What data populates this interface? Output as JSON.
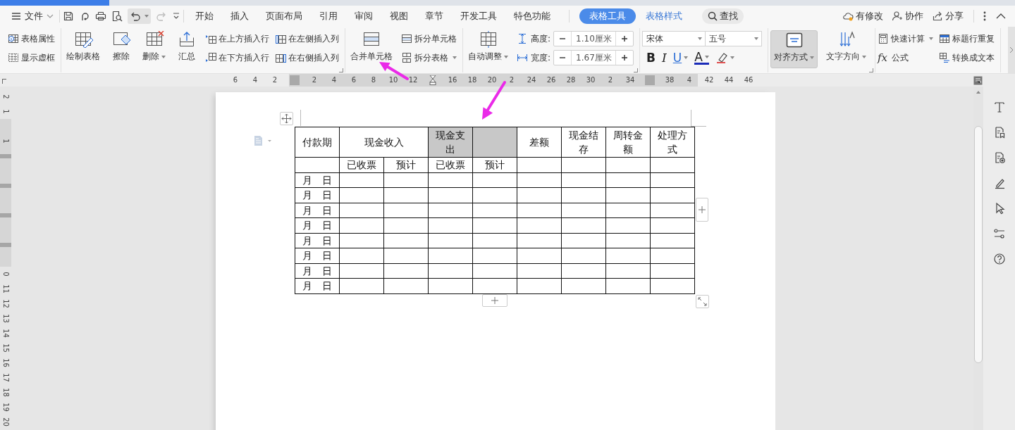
{
  "menu": {
    "file": "文件",
    "tabs": [
      {
        "label": "开始",
        "selected": false,
        "kind": "main"
      },
      {
        "label": "插入",
        "selected": false,
        "kind": "main"
      },
      {
        "label": "页面布局",
        "selected": false,
        "kind": "main"
      },
      {
        "label": "引用",
        "selected": false,
        "kind": "main"
      },
      {
        "label": "审阅",
        "selected": false,
        "kind": "main"
      },
      {
        "label": "视图",
        "selected": false,
        "kind": "main"
      },
      {
        "label": "章节",
        "selected": false,
        "kind": "main"
      },
      {
        "label": "开发工具",
        "selected": false,
        "kind": "main"
      },
      {
        "label": "特色功能",
        "selected": false,
        "kind": "main"
      },
      {
        "label": "表格工具",
        "selected": true,
        "kind": "context"
      },
      {
        "label": "表格样式",
        "selected": false,
        "kind": "context"
      }
    ],
    "search": "查找",
    "actions": [
      "有修改",
      "协作",
      "分享"
    ]
  },
  "ribbon": {
    "groups": [
      {
        "columns": [
          {
            "kind": "small",
            "items": [
              {
                "label": "表格属性"
              },
              {
                "label": "显示虚框"
              }
            ]
          }
        ]
      },
      {
        "launcher": true,
        "columns": [
          {
            "kind": "large",
            "items": [
              {
                "label": "绘制表格"
              }
            ]
          },
          {
            "kind": "large",
            "items": [
              {
                "label": "擦除"
              }
            ]
          },
          {
            "kind": "large",
            "items": [
              {
                "label": "删除",
                "dropdown": true
              }
            ]
          },
          {
            "kind": "large",
            "items": [
              {
                "label": "汇总"
              }
            ]
          },
          {
            "kind": "small",
            "items": [
              {
                "label": "在上方插入行"
              },
              {
                "label": "在下方插入行"
              }
            ]
          },
          {
            "kind": "small",
            "items": [
              {
                "label": "在左侧插入列"
              },
              {
                "label": "在右侧插入列"
              }
            ]
          }
        ]
      },
      {
        "columns": [
          {
            "kind": "large",
            "items": [
              {
                "label": "合并单元格"
              }
            ]
          },
          {
            "kind": "small",
            "items": [
              {
                "label": "拆分单元格"
              },
              {
                "label": "拆分表格",
                "dropdown": true
              }
            ]
          }
        ]
      },
      {
        "launcher": true,
        "columns": [
          {
            "kind": "large",
            "items": [
              {
                "label": "自动调整",
                "dropdown": true
              }
            ]
          },
          {
            "kind": "spin",
            "items": [
              {
                "label": "高度:",
                "value": "1.10厘米"
              },
              {
                "label": "宽度:",
                "value": "1.67厘米"
              }
            ]
          }
        ]
      },
      {
        "columns": [
          {
            "kind": "font",
            "font": "宋体",
            "size": "五号",
            "format": [
              {
                "kind": "bold",
                "label": "B"
              },
              {
                "kind": "italic",
                "label": "I"
              },
              {
                "kind": "underline",
                "label": "U",
                "dropdown": true
              },
              {
                "kind": "color",
                "label": "A",
                "dropdown": true
              },
              {
                "kind": "highlight",
                "dropdown": true
              }
            ]
          }
        ]
      },
      {
        "launcher": true,
        "columns": [
          {
            "kind": "large",
            "items": [
              {
                "label": "对齐方式",
                "dropdown": true,
                "selected": true
              }
            ]
          },
          {
            "kind": "large",
            "items": [
              {
                "label": "文字方向",
                "dropdown": true,
                "selected": false
              }
            ]
          }
        ]
      },
      {
        "columns": [
          {
            "kind": "small",
            "items": [
              {
                "label": "快速计算",
                "dropdown": true
              },
              {
                "label": "公式",
                "glyph": "fx"
              }
            ]
          },
          {
            "kind": "small",
            "items": [
              {
                "label": "标题行重复"
              },
              {
                "label": "转换成文本"
              }
            ]
          }
        ]
      }
    ]
  },
  "ruler": {
    "ticks": [
      {
        "text": "6"
      },
      {
        "text": "4"
      },
      {
        "text": "2"
      },
      {
        "kind": "marker"
      },
      {
        "text": "2"
      },
      {
        "text": "4"
      },
      {
        "text": "6"
      },
      {
        "text": "8"
      },
      {
        "text": "10"
      },
      {
        "text": "12"
      },
      {
        "kind": "indent"
      },
      {
        "text": "16"
      },
      {
        "text": "18"
      },
      {
        "text": "20"
      },
      {
        "text": "2"
      },
      {
        "text": "24"
      },
      {
        "text": "26"
      },
      {
        "text": "28"
      },
      {
        "text": "30"
      },
      {
        "text": "2"
      },
      {
        "text": "34"
      },
      {
        "kind": "marker"
      },
      {
        "text": "38"
      },
      {
        "text": "4"
      },
      {
        "text": "42"
      },
      {
        "text": "44"
      },
      {
        "text": "46"
      }
    ],
    "vertical": [
      {
        "text": "2"
      },
      {
        "text": "1"
      },
      {
        "kind": "blank"
      },
      {
        "text": "1"
      },
      {
        "kind": "marker"
      },
      {
        "kind": "blank"
      },
      {
        "kind": "marker"
      },
      {
        "kind": "blank"
      },
      {
        "kind": "marker"
      },
      {
        "kind": "blank"
      },
      {
        "kind": "marker"
      },
      {
        "kind": "blank"
      },
      {
        "text": "0"
      },
      {
        "text": "11"
      },
      {
        "text": "12"
      },
      {
        "text": "13"
      },
      {
        "text": "14"
      },
      {
        "text": "15"
      },
      {
        "text": "16"
      },
      {
        "text": "17"
      },
      {
        "text": "18"
      },
      {
        "text": "19"
      },
      {
        "text": "20"
      }
    ]
  },
  "table": {
    "rows": [
      {
        "cells": [
          {
            "text": "付款期",
            "selected": false
          },
          {
            "text": "现金收入",
            "colspan": 2,
            "selected": false
          },
          {
            "text": "现金支出",
            "selected": true
          },
          {
            "selected": true
          },
          {
            "text": "差额",
            "selected": false
          },
          {
            "text": "现金结存",
            "selected": false
          },
          {
            "text": "周转金额",
            "selected": false
          },
          {
            "text": "处理方式",
            "selected": false
          }
        ]
      },
      {
        "cells": [
          {
            "selected": false
          },
          {
            "text": "已收票",
            "selected": false
          },
          {
            "text": "预计",
            "selected": false
          },
          {
            "text": "已收票",
            "selected": false
          },
          {
            "text": "预计",
            "selected": false
          },
          {
            "selected": false
          },
          {
            "selected": false
          },
          {
            "selected": false
          },
          {
            "selected": false
          }
        ]
      },
      {
        "cells": [
          {
            "text": "月   日",
            "selected": false
          },
          {
            "selected": false
          },
          {
            "selected": false
          },
          {
            "selected": false
          },
          {
            "selected": false
          },
          {
            "selected": false
          },
          {
            "selected": false
          },
          {
            "selected": false
          },
          {
            "selected": false
          }
        ]
      },
      {
        "cells": [
          {
            "text": "月   日",
            "selected": false
          },
          {
            "selected": false
          },
          {
            "selected": false
          },
          {
            "selected": false
          },
          {
            "selected": false
          },
          {
            "selected": false
          },
          {
            "selected": false
          },
          {
            "selected": false
          },
          {
            "selected": false
          }
        ]
      },
      {
        "cells": [
          {
            "text": "月   日",
            "selected": false
          },
          {
            "selected": false
          },
          {
            "selected": false
          },
          {
            "selected": false
          },
          {
            "selected": false
          },
          {
            "selected": false
          },
          {
            "selected": false
          },
          {
            "selected": false
          },
          {
            "selected": false
          }
        ]
      },
      {
        "cells": [
          {
            "text": "月   日",
            "selected": false
          },
          {
            "selected": false
          },
          {
            "selected": false
          },
          {
            "selected": false
          },
          {
            "selected": false
          },
          {
            "selected": false
          },
          {
            "selected": false
          },
          {
            "selected": false
          },
          {
            "selected": false
          }
        ]
      },
      {
        "cells": [
          {
            "text": "月   日",
            "selected": false
          },
          {
            "selected": false
          },
          {
            "selected": false
          },
          {
            "selected": false
          },
          {
            "selected": false
          },
          {
            "selected": false
          },
          {
            "selected": false
          },
          {
            "selected": false
          },
          {
            "selected": false
          }
        ]
      },
      {
        "cells": [
          {
            "text": "月   日",
            "selected": false
          },
          {
            "selected": false
          },
          {
            "selected": false
          },
          {
            "selected": false
          },
          {
            "selected": false
          },
          {
            "selected": false
          },
          {
            "selected": false
          },
          {
            "selected": false
          },
          {
            "selected": false
          }
        ]
      },
      {
        "cells": [
          {
            "text": "月   日",
            "selected": false
          },
          {
            "selected": false
          },
          {
            "selected": false
          },
          {
            "selected": false
          },
          {
            "selected": false
          },
          {
            "selected": false
          },
          {
            "selected": false
          },
          {
            "selected": false
          },
          {
            "selected": false
          }
        ]
      },
      {
        "cells": [
          {
            "text": "月   日",
            "selected": false
          },
          {
            "selected": false
          },
          {
            "selected": false
          },
          {
            "selected": false
          },
          {
            "selected": false
          },
          {
            "selected": false
          },
          {
            "selected": false
          },
          {
            "selected": false
          },
          {
            "selected": false
          }
        ]
      }
    ]
  }
}
